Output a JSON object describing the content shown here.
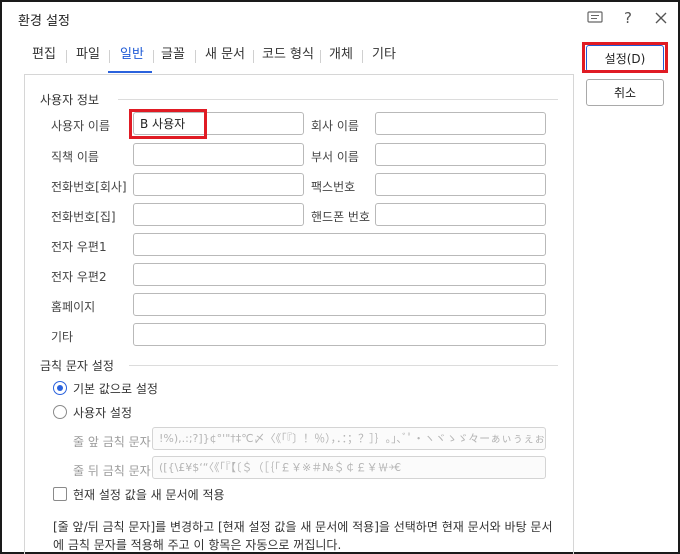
{
  "window": {
    "title": "환경 설정"
  },
  "titlebar_icons": [
    "chat-icon",
    "help-icon",
    "close-icon"
  ],
  "help_label": "?",
  "tabs": [
    {
      "label": "편집",
      "active": false
    },
    {
      "label": "파일",
      "active": false
    },
    {
      "label": "일반",
      "active": true
    },
    {
      "label": "글꼴",
      "active": false
    },
    {
      "label": "새 문서",
      "active": false
    },
    {
      "label": "코드 형식",
      "active": false
    },
    {
      "label": "개체",
      "active": false
    },
    {
      "label": "기타",
      "active": false
    }
  ],
  "user_info": {
    "title": "사용자 정보",
    "user_name_label": "사용자 이름",
    "user_name_value": "B 사용자",
    "company_label": "회사 이름",
    "company_value": "",
    "position_label": "직책 이름",
    "position_value": "",
    "department_label": "부서 이름",
    "department_value": "",
    "phone_company_label": "전화번호[회사]",
    "phone_company_value": "",
    "fax_label": "팩스번호",
    "fax_value": "",
    "phone_home_label": "전화번호[집]",
    "phone_home_value": "",
    "mobile_label": "핸드폰 번호",
    "mobile_value": "",
    "email1_label": "전자 우편1",
    "email1_value": "",
    "email2_label": "전자 우편2",
    "email2_value": "",
    "homepage_label": "홈페이지",
    "homepage_value": "",
    "etc_label": "기타",
    "etc_value": ""
  },
  "forbidden_chars": {
    "title": "금칙 문자 설정",
    "default_label": "기본 값으로 설정",
    "custom_label": "사용자 설정",
    "selected": "default",
    "line_start_label": "줄 앞 금칙 문자",
    "line_start_value": "!%),.:;?]}¢°'\"†‡℃〆〈《「『〕！％），．：；？］｝｡｣､ﾞﾟ・ヽヾゝゞ々ーぁぃぅぇぉっゃ",
    "line_end_label": "줄 뒤 금칙 문자",
    "line_end_value": "([{\\£¥$‘“〈《「『【〔＄（［｛｢￡￥※＃№＄￠￡￥￦￫€",
    "apply_label": "현재 설정 값을 새 문서에 적용",
    "apply_checked": false
  },
  "notes": {
    "line1": "[줄 앞/뒤 금칙 문자]를 변경하고 [현재 설정 값을 새 문서에 적용]을 선택하면 현재 문서와 바탕 문서",
    "line2": "에 금칙 문자를 적용해 주고 이 항목은 자동으로 꺼집니다."
  },
  "buttons": {
    "ok_label": "설정(D)",
    "cancel_label": "취소"
  },
  "colors": {
    "accent": "#2a62dd",
    "highlight": "#e01b24"
  }
}
